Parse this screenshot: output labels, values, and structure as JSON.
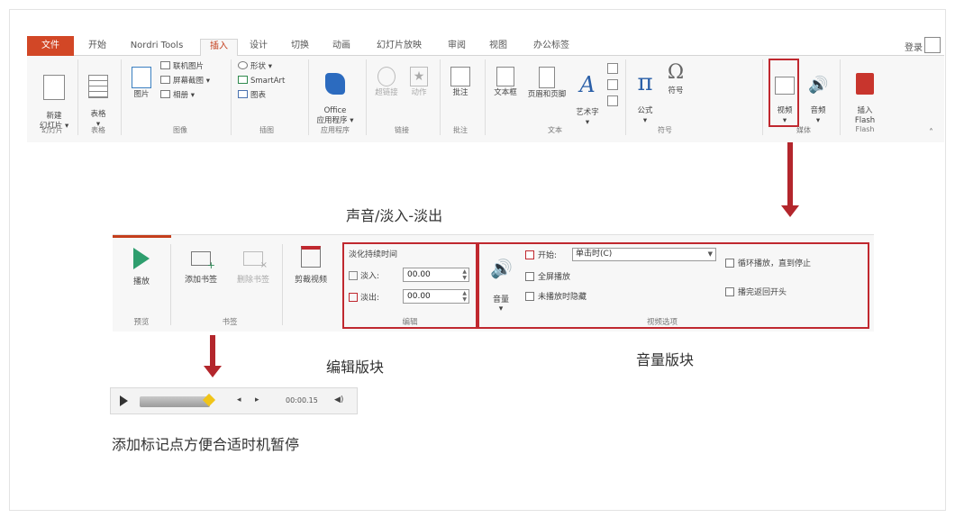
{
  "ribbon": {
    "tabs": [
      {
        "label": "文件"
      },
      {
        "label": "开始"
      },
      {
        "label": "Nordri Tools"
      },
      {
        "label": "插入"
      },
      {
        "label": "设计"
      },
      {
        "label": "切换"
      },
      {
        "label": "动画"
      },
      {
        "label": "幻灯片放映"
      },
      {
        "label": "审阅"
      },
      {
        "label": "视图"
      },
      {
        "label": "办公标签"
      }
    ],
    "login": "登录",
    "buttons": {
      "new_slide": "新建\n幻灯片 ▾",
      "table": "表格\n▾",
      "picture": "图片",
      "online_picture": "联机图片",
      "screenshot": "屏幕截图 ▾",
      "album": "相册 ▾",
      "shapes": "形状 ▾",
      "smartart": "SmartArt",
      "chart": "图表",
      "office_apps": "Office\n应用程序 ▾",
      "hyperlink": "超链接",
      "action": "动作",
      "comment": "批注",
      "textbox": "文本框",
      "header_footer": "页眉和页脚",
      "wordart": "艺术字\n▾",
      "equation": "公式\n▾",
      "symbol": "符号",
      "video": "视频\n▾",
      "audio": "音频\n▾",
      "flash": "插入\nFlash"
    },
    "groups": {
      "slides": "幻灯片",
      "tables": "表格",
      "images": "图像",
      "illustrations": "插图",
      "apps": "应用程序",
      "links": "链接",
      "comments": "批注",
      "text": "文本",
      "symbols": "符号",
      "media": "媒体",
      "flash": "Flash"
    }
  },
  "captions": {
    "fade": "声音/淡入-淡出",
    "edit_block": "编辑版块",
    "volume_block": "音量版块",
    "bookmark_tip": "添加标记点方便合适时机暂停"
  },
  "playback": {
    "play": "播放",
    "add_bookmark": "添加书签",
    "remove_bookmark": "删除书签",
    "trim_video": "剪裁视频",
    "fade_duration": "淡化持续时间",
    "fade_in_label": "淡入:",
    "fade_in_value": "00.00",
    "fade_out_label": "淡出:",
    "fade_out_value": "00.00",
    "volume": "音量\n▾",
    "start_label": "开始:",
    "start_value": "单击时(C)",
    "fullscreen": "全屏播放",
    "hide_when_not_playing": "未播放时隐藏",
    "loop_until_stopped": "循环播放，直到停止",
    "rewind_after_playing": "播完返回开头",
    "groups": {
      "preview": "预览",
      "bookmarks": "书签",
      "editing": "编辑",
      "video_options": "视频选项"
    }
  },
  "media_bar": {
    "time": "00:00.15"
  },
  "colors": {
    "accent_red": "#c0282f",
    "file_tab": "#d24726",
    "play_green": "#2e9e6e"
  }
}
